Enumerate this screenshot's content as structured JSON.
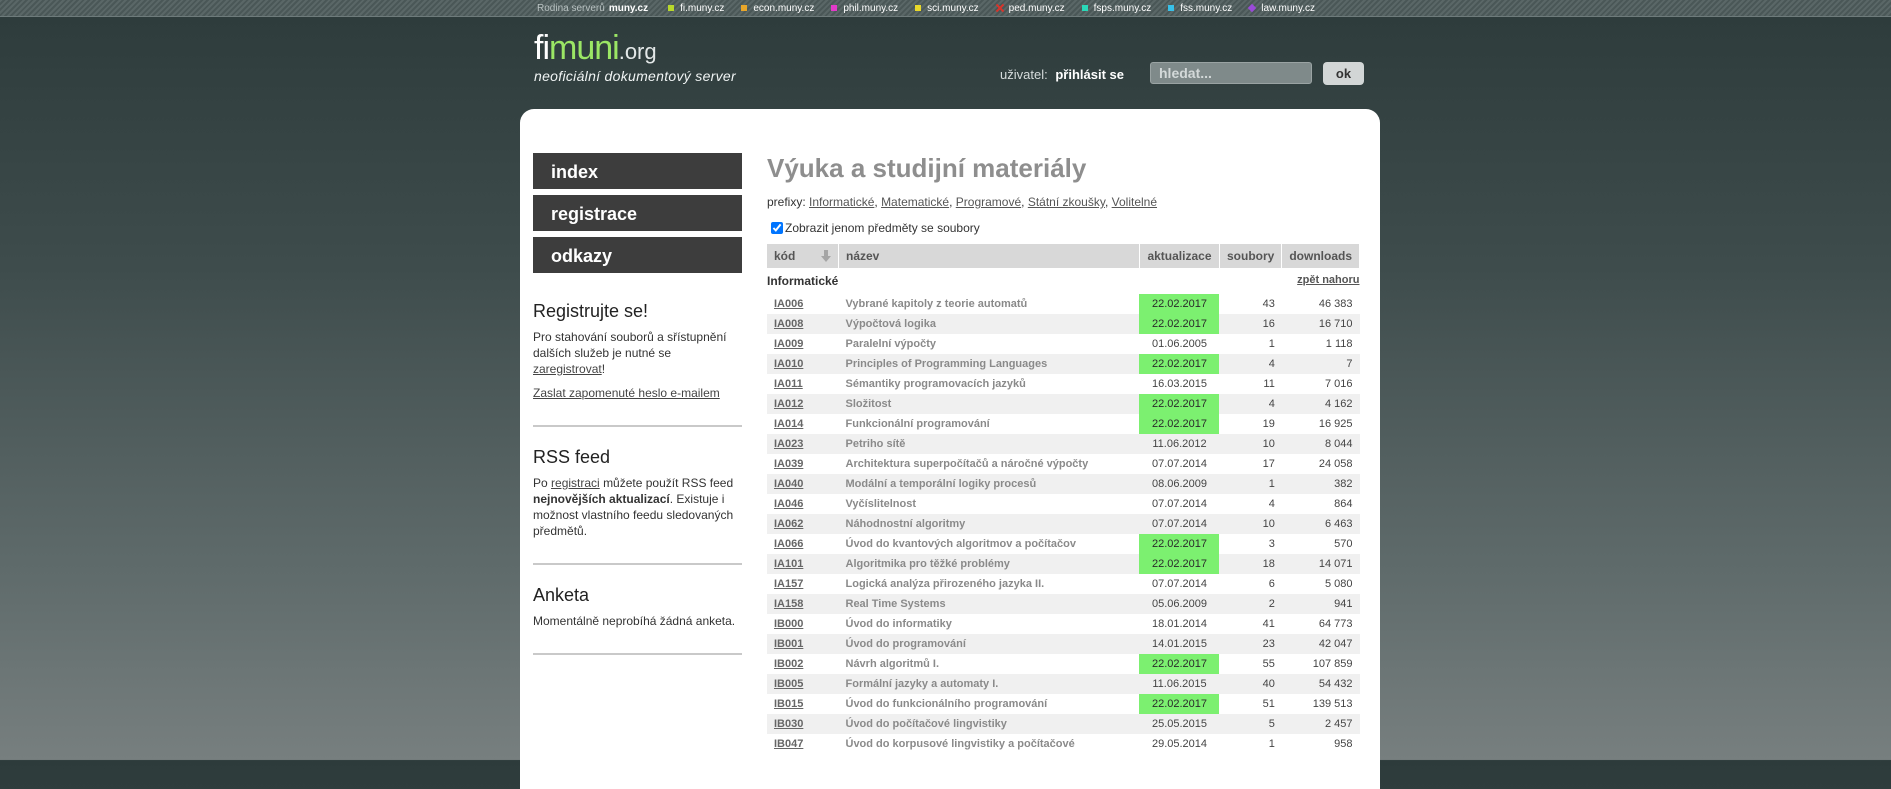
{
  "netbar": {
    "family_label": "Rodina serverů",
    "family_brand": "muny.cz",
    "sites": [
      {
        "label": "fi.muny.cz",
        "color": "#b8d82b",
        "shape": "square"
      },
      {
        "label": "econ.muny.cz",
        "color": "#e8a62a",
        "shape": "square"
      },
      {
        "label": "phil.muny.cz",
        "color": "#e23ac9",
        "shape": "square"
      },
      {
        "label": "sci.muny.cz",
        "color": "#e8d82a",
        "shape": "square"
      },
      {
        "label": "ped.muny.cz",
        "color": "#d9332a",
        "shape": "x"
      },
      {
        "label": "fsps.muny.cz",
        "color": "#2ad8b8",
        "shape": "square"
      },
      {
        "label": "fss.muny.cz",
        "color": "#38c0e8",
        "shape": "square"
      },
      {
        "label": "law.muny.cz",
        "color": "#9a4ad8",
        "shape": "diamond"
      }
    ]
  },
  "header": {
    "logo_part1": "fi",
    "logo_part2": "muni",
    "logo_part3": ".org",
    "logo_tagline": "neoficiální dokumentový server",
    "user_label": "uživatel:",
    "login_link": "přihlásit se",
    "search_placeholder": "hledat...",
    "search_button": "ok"
  },
  "nav": [
    {
      "label": "index"
    },
    {
      "label": "registrace"
    },
    {
      "label": "odkazy"
    }
  ],
  "sidebar": {
    "register_title": "Registrujte se!",
    "register_text": "Pro stahování souborů a sřístupnění dalších služeb je nutné se",
    "register_link": "zaregistrovat",
    "register_text_end": "!",
    "forgot_link": "Zaslat zapomenuté heslo e-mailem",
    "rss_title": "RSS feed",
    "rss_text1": "Po",
    "rss_link": "registraci",
    "rss_text2": "můžete použít RSS feed",
    "rss_bold": "nejnovějších aktualizací",
    "rss_text3": ". Existuje i možnost vlastního feedu sledovaných předmětů.",
    "poll_title": "Anketa",
    "poll_text": "Momentálně neprobíhá žádná anketa."
  },
  "main": {
    "title": "Výuka a studijní materiály",
    "prefix_label": "prefixy:",
    "prefixes": [
      "Informatické",
      "Matematické",
      "Programové",
      "Státní zkoušky",
      "Volitelné"
    ],
    "filter_label": "Zobrazit jenom předměty se soubory",
    "filter_checked": true,
    "columns": [
      "kód",
      "název",
      "aktualizace",
      "soubory",
      "downloads"
    ],
    "group_name": "Informatické",
    "back_to_top": "zpět nahoru",
    "rows": [
      {
        "code": "IA006",
        "name": "Vybrané kapitoly z teorie automatů",
        "date": "22.02.2017",
        "new": true,
        "files": "43",
        "downloads": "46 383"
      },
      {
        "code": "IA008",
        "name": "Výpočtová logika",
        "date": "22.02.2017",
        "new": true,
        "files": "16",
        "downloads": "16 710"
      },
      {
        "code": "IA009",
        "name": "Paralelní výpočty",
        "date": "01.06.2005",
        "new": false,
        "files": "1",
        "downloads": "1 118"
      },
      {
        "code": "IA010",
        "name": "Principles of Programming Languages",
        "date": "22.02.2017",
        "new": true,
        "files": "4",
        "downloads": "7"
      },
      {
        "code": "IA011",
        "name": "Sémantiky programovacích jazyků",
        "date": "16.03.2015",
        "new": false,
        "files": "11",
        "downloads": "7 016"
      },
      {
        "code": "IA012",
        "name": "Složitost",
        "date": "22.02.2017",
        "new": true,
        "files": "4",
        "downloads": "4 162"
      },
      {
        "code": "IA014",
        "name": "Funkcionální programování",
        "date": "22.02.2017",
        "new": true,
        "files": "19",
        "downloads": "16 925"
      },
      {
        "code": "IA023",
        "name": "Petriho sítě",
        "date": "11.06.2012",
        "new": false,
        "files": "10",
        "downloads": "8 044"
      },
      {
        "code": "IA039",
        "name": "Architektura superpočítačů a náročné výpočty",
        "date": "07.07.2014",
        "new": false,
        "files": "17",
        "downloads": "24 058"
      },
      {
        "code": "IA040",
        "name": "Modální a temporální logiky procesů",
        "date": "08.06.2009",
        "new": false,
        "files": "1",
        "downloads": "382"
      },
      {
        "code": "IA046",
        "name": "Vyčíslitelnost",
        "date": "07.07.2014",
        "new": false,
        "files": "4",
        "downloads": "864"
      },
      {
        "code": "IA062",
        "name": "Náhodnostní algoritmy",
        "date": "07.07.2014",
        "new": false,
        "files": "10",
        "downloads": "6 463"
      },
      {
        "code": "IA066",
        "name": "Úvod do kvantových algoritmov a počítačov",
        "date": "22.02.2017",
        "new": true,
        "files": "3",
        "downloads": "570"
      },
      {
        "code": "IA101",
        "name": "Algoritmika pro těžké problémy",
        "date": "22.02.2017",
        "new": true,
        "files": "18",
        "downloads": "14 071"
      },
      {
        "code": "IA157",
        "name": "Logická analýza přirozeného jazyka II.",
        "date": "07.07.2014",
        "new": false,
        "files": "6",
        "downloads": "5 080"
      },
      {
        "code": "IA158",
        "name": "Real Time Systems",
        "date": "05.06.2009",
        "new": false,
        "files": "2",
        "downloads": "941"
      },
      {
        "code": "IB000",
        "name": "Úvod do informatiky",
        "date": "18.01.2014",
        "new": false,
        "files": "41",
        "downloads": "64 773"
      },
      {
        "code": "IB001",
        "name": "Úvod do programování",
        "date": "14.01.2015",
        "new": false,
        "files": "23",
        "downloads": "42 047"
      },
      {
        "code": "IB002",
        "name": "Návrh algoritmů I.",
        "date": "22.02.2017",
        "new": true,
        "files": "55",
        "downloads": "107 859"
      },
      {
        "code": "IB005",
        "name": "Formální jazyky a automaty I.",
        "date": "11.06.2015",
        "new": false,
        "files": "40",
        "downloads": "54 432"
      },
      {
        "code": "IB015",
        "name": "Úvod do funkcionálního programování",
        "date": "22.02.2017",
        "new": true,
        "files": "51",
        "downloads": "139 513"
      },
      {
        "code": "IB030",
        "name": "Úvod do počítačové lingvistiky",
        "date": "25.05.2015",
        "new": false,
        "files": "5",
        "downloads": "2 457"
      },
      {
        "code": "IB047",
        "name": "Úvod do korpusové lingvistiky a počítačové",
        "date": "29.05.2014",
        "new": false,
        "files": "1",
        "downloads": "958"
      }
    ]
  }
}
